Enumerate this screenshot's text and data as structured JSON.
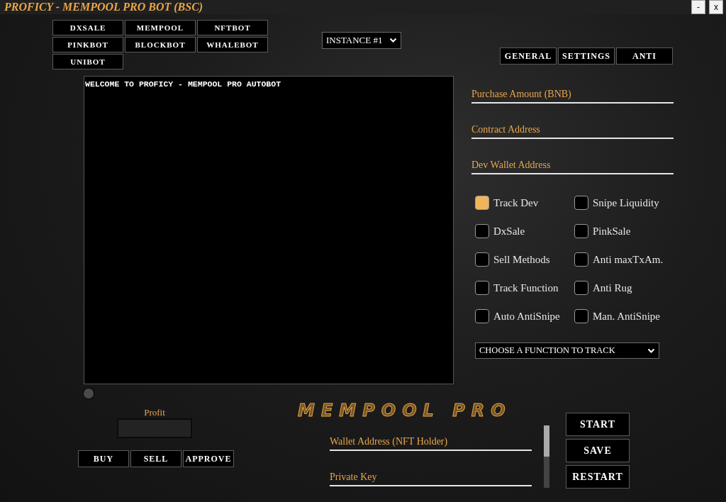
{
  "window": {
    "title": "PROFICY - MEMPOOL PRO BOT (BSC)",
    "controls": [
      "-",
      "x"
    ]
  },
  "bot_tabs": [
    "DXSALE",
    "MEMPOOL",
    "NFTBOT",
    "PINKBOT",
    "BLOCKBOT",
    "WHALEBOT",
    "UNIBOT"
  ],
  "instance_select": {
    "value": "INSTANCE #1"
  },
  "tabs": [
    "GENERAL",
    "SETTINGS",
    "ANTI"
  ],
  "console": {
    "lines": [
      "WELCOME TO PROFICY - MEMPOOL PRO AUTOBOT"
    ]
  },
  "fields": [
    {
      "placeholder": "Purchase Amount (BNB)"
    },
    {
      "placeholder": "Contract Address"
    },
    {
      "placeholder": "Dev Wallet Address"
    }
  ],
  "options": [
    {
      "label": "Track Dev",
      "checked": true
    },
    {
      "label": "Snipe Liquidity",
      "checked": false
    },
    {
      "label": "DxSale",
      "checked": false
    },
    {
      "label": "PinkSale",
      "checked": false
    },
    {
      "label": "Sell Methods",
      "checked": false
    },
    {
      "label": "Anti maxTxAm.",
      "checked": false
    },
    {
      "label": "Track Function",
      "checked": false
    },
    {
      "label": "Anti Rug",
      "checked": false
    },
    {
      "label": "Auto AntiSnipe",
      "checked": false
    },
    {
      "label": "Man. AntiSnipe",
      "checked": false
    }
  ],
  "function_select": {
    "value": "CHOOSE A FUNCTION TO TRACK"
  },
  "profit": {
    "label": "Profit"
  },
  "trade_buttons": [
    "BUY",
    "SELL",
    "APPROVE"
  ],
  "logo": "MEMPOOL PRO",
  "wallet_fields": [
    {
      "placeholder": "Wallet Address (NFT Holder)"
    },
    {
      "placeholder": "Private Key"
    }
  ],
  "action_buttons": [
    "START",
    "SAVE",
    "RESTART"
  ]
}
